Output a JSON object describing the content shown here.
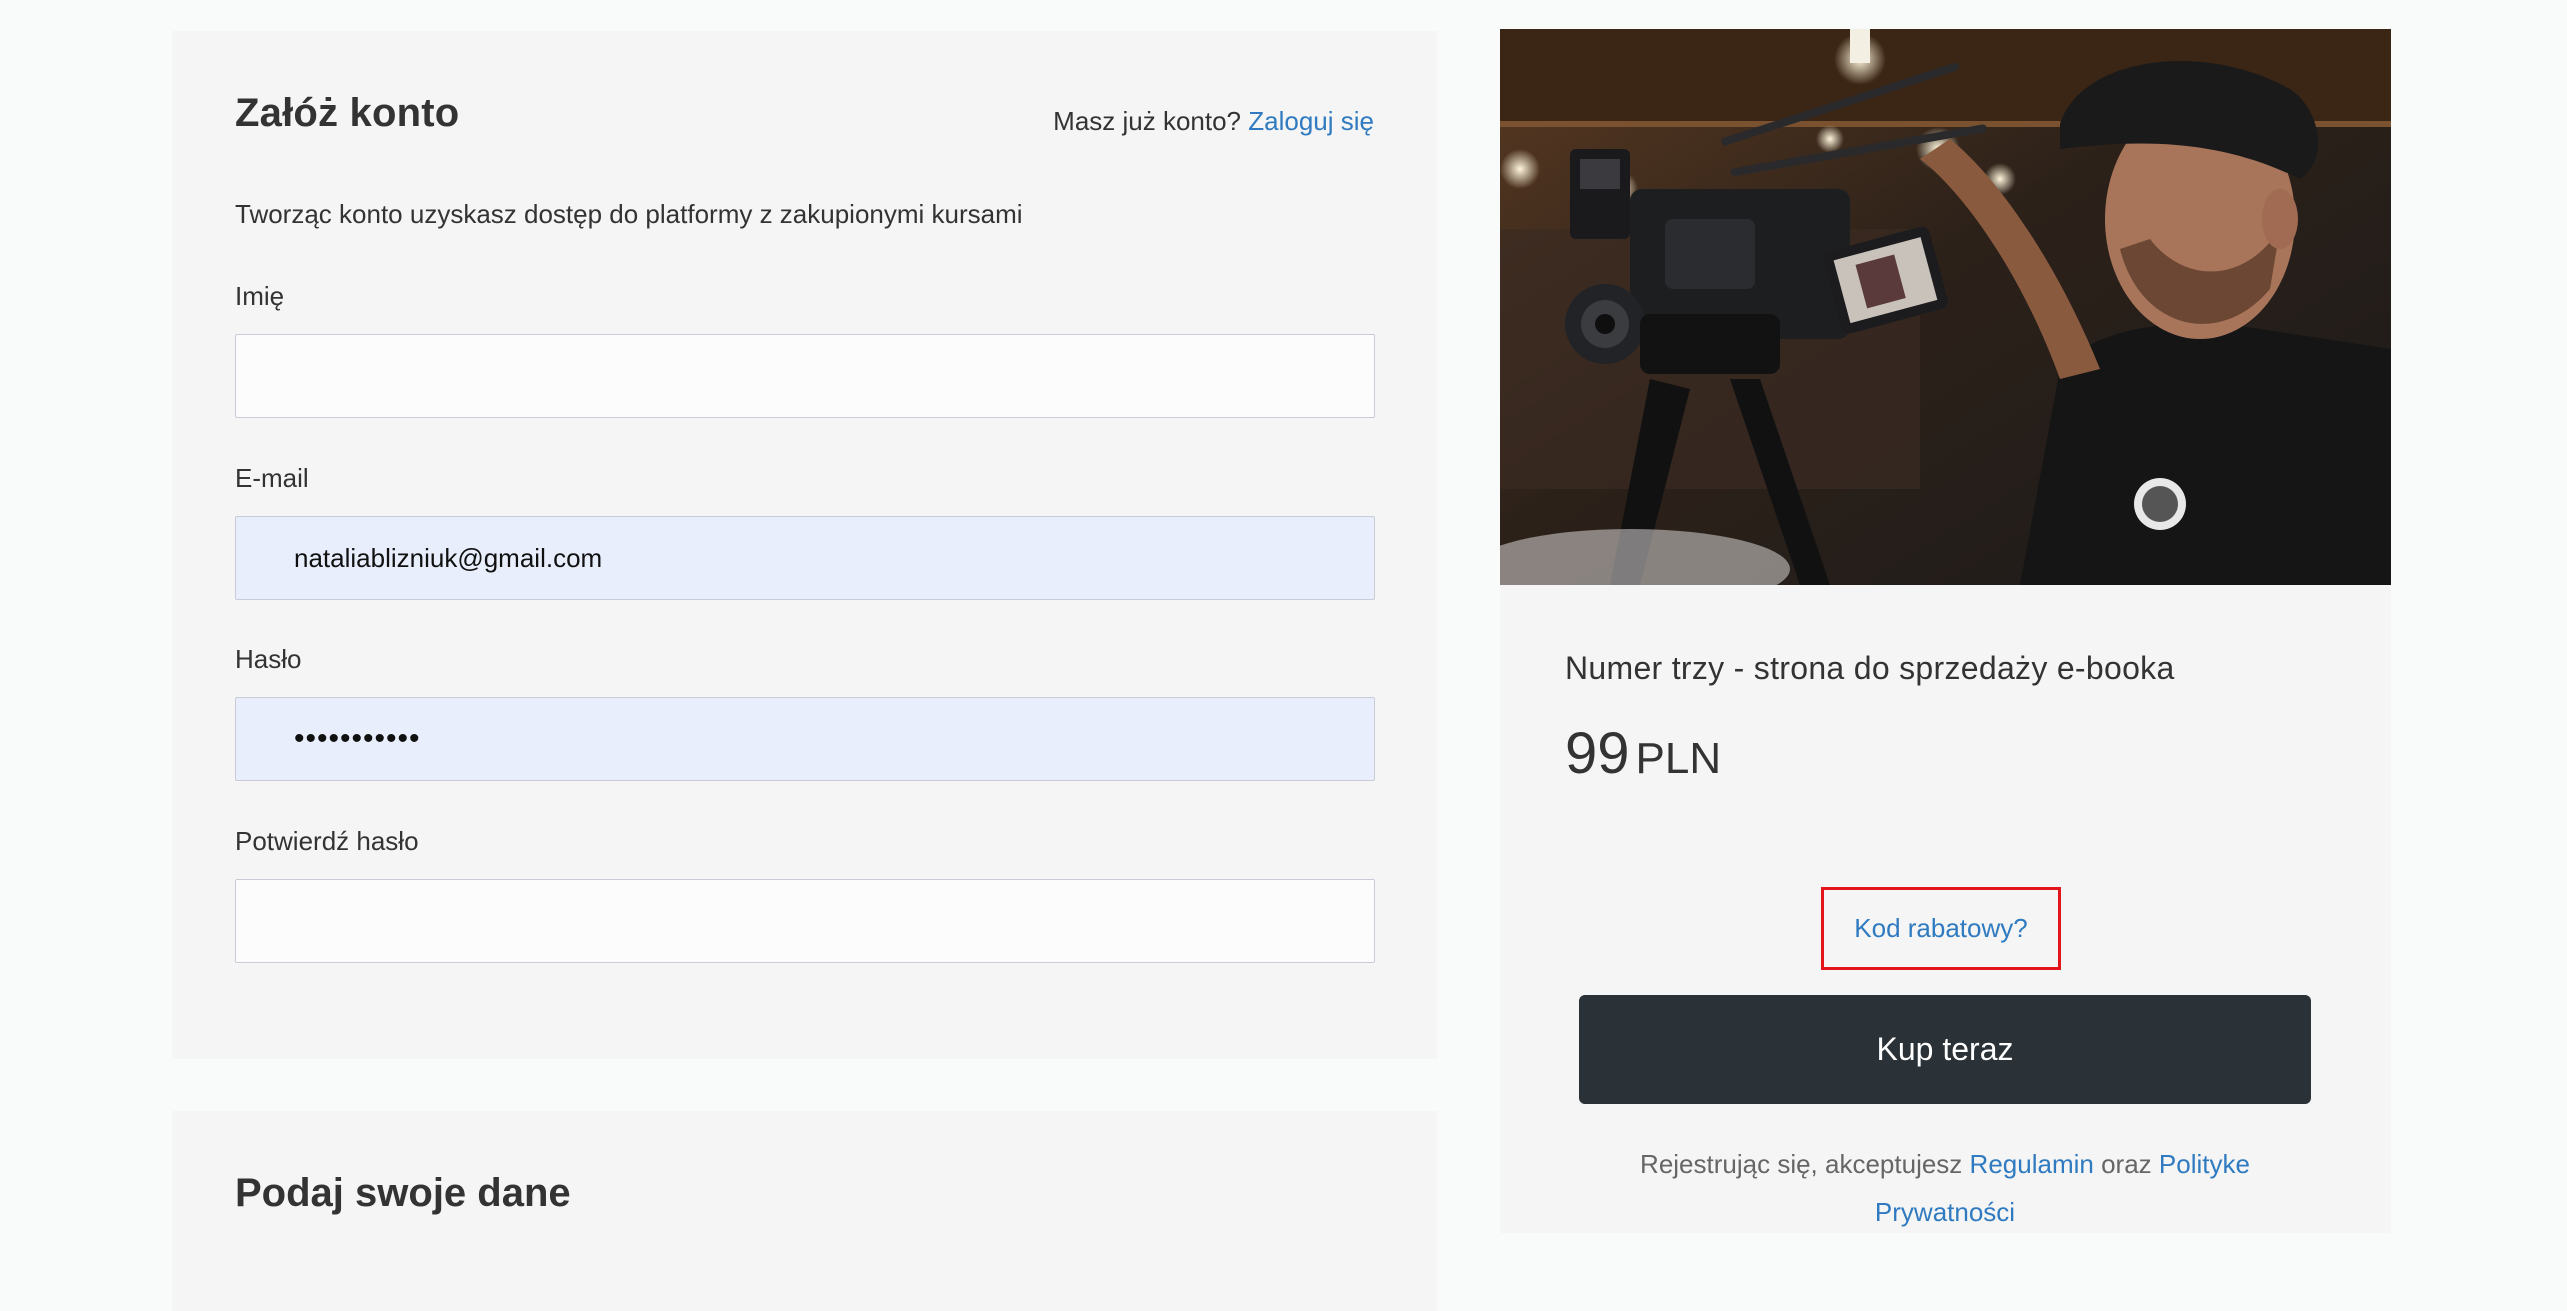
{
  "account": {
    "title": "Załóż konto",
    "login_prompt": "Masz już konto?",
    "login_link": "Zaloguj się",
    "subtitle": "Tworząc konto uzyskasz dostęp do platformy z zakupionymi kursami",
    "fields": {
      "first_name": {
        "label": "Imię",
        "value": ""
      },
      "email": {
        "label": "E-mail",
        "value": "nataliablizniuk@gmail.com"
      },
      "password": {
        "label": "Hasło",
        "value": "•••••••••••"
      },
      "confirm_password": {
        "label": "Potwierdź hasło",
        "value": ""
      }
    }
  },
  "details": {
    "title": "Podaj swoje dane"
  },
  "product": {
    "image_icon": "photographer-with-camera-photo",
    "name": "Numer trzy - strona do sprzedaży e-booka",
    "price": "99",
    "currency": "PLN",
    "coupon_link": "Kod rabatowy?",
    "buy_button": "Kup teraz",
    "terms_prefix": "Rejestrując się, akceptujesz",
    "terms_link": "Regulamin",
    "terms_middle": "oraz",
    "privacy_link": "Polityke Prywatności"
  },
  "colors": {
    "link": "#2f7ac0",
    "button": "#2a3238",
    "highlight_border": "#e3141b",
    "autofill": "#e8eefb"
  }
}
